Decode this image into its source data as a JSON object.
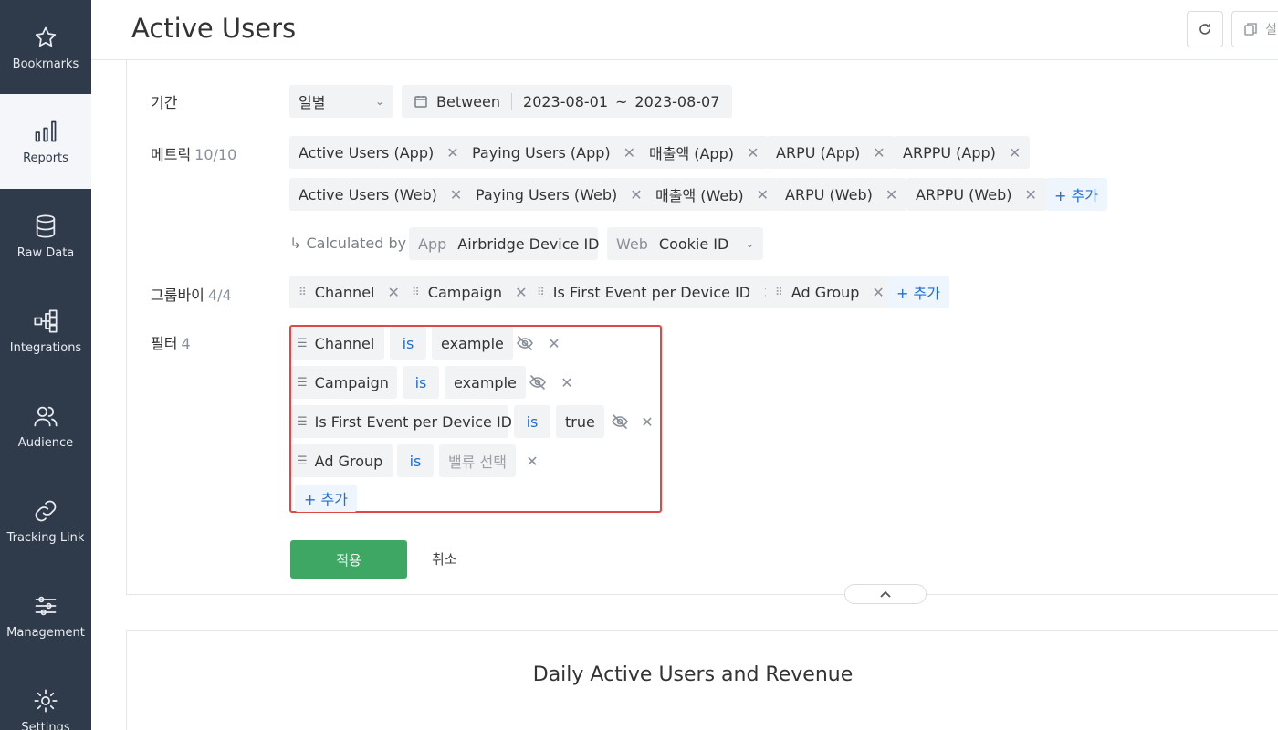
{
  "sidebar": {
    "items": [
      {
        "label": "Bookmarks",
        "icon": "star-icon"
      },
      {
        "label": "Reports",
        "icon": "bar-chart-icon"
      },
      {
        "label": "Raw Data",
        "icon": "database-icon"
      },
      {
        "label": "Integrations",
        "icon": "integrations-icon"
      },
      {
        "label": "Audience",
        "icon": "audience-icon"
      },
      {
        "label": "Tracking Link",
        "icon": "link-icon"
      },
      {
        "label": "Management",
        "icon": "sliders-icon"
      },
      {
        "label": "Settings",
        "icon": "gear-icon"
      }
    ],
    "active": "Reports"
  },
  "header": {
    "title": "Active Users",
    "save_label": "설"
  },
  "config": {
    "period": {
      "label": "기간",
      "granularity": "일별",
      "mode": "Between",
      "start": "2023-08-01",
      "tilde": "~",
      "end": "2023-08-07"
    },
    "metrics": {
      "label": "메트릭",
      "count": "10/10",
      "items": [
        "Active Users (App)",
        "Paying Users (App)",
        "매출액 (App)",
        "ARPU (App)",
        "ARPPU (App)",
        "Active Users (Web)",
        "Paying Users (Web)",
        "매출액 (Web)",
        "ARPU (Web)",
        "ARPPU (Web)"
      ],
      "add_label": "+ 추가",
      "calculated_by": {
        "label": "↳ Calculated by",
        "app_prefix": "App",
        "app_value": "Airbridge Device ID",
        "web_prefix": "Web",
        "web_value": "Cookie ID"
      }
    },
    "group_by": {
      "label": "그룹바이",
      "count": "4/4",
      "items": [
        "Channel",
        "Campaign",
        "Is First Event per Device ID",
        "Ad Group"
      ],
      "add_label": "+ 추가"
    },
    "filter": {
      "label": "필터",
      "count": "4",
      "rows": [
        {
          "field": "Channel",
          "op": "is",
          "value": "example",
          "hidden_toggle": true,
          "placeholder": false
        },
        {
          "field": "Campaign",
          "op": "is",
          "value": "example",
          "hidden_toggle": true,
          "placeholder": false
        },
        {
          "field": "Is First Event per Device ID",
          "op": "is",
          "value": "true",
          "hidden_toggle": true,
          "placeholder": false
        },
        {
          "field": "Ad Group",
          "op": "is",
          "value": "밸류 선택",
          "hidden_toggle": false,
          "placeholder": true
        }
      ],
      "add_label": "+ 추가"
    },
    "apply_label": "적용",
    "cancel_label": "취소"
  },
  "chart": {
    "title": "Daily Active Users and Revenue"
  },
  "colors": {
    "sidebar_bg": "#2f3b4a",
    "accent_blue": "#1f6fd6",
    "apply_green": "#3ea764",
    "highlight_red": "#e04848"
  }
}
